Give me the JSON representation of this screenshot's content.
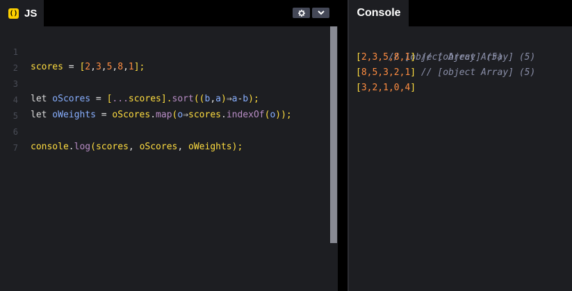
{
  "js_panel": {
    "badge": "()",
    "title": "JS",
    "settings_icon": "gear-icon",
    "collapse_icon": "chevron-down-icon",
    "line_numbers": [
      "1",
      "2",
      "3",
      "4",
      "5",
      "6",
      "7"
    ],
    "code": {
      "l1": {
        "a": "scores",
        "b": " = ",
        "c": "[",
        "d": "2",
        "e": ",",
        "f": "3",
        "g": ",",
        "h": "5",
        "i": ",",
        "j": "8",
        "k": ",",
        "l": "1",
        "m": "];"
      },
      "l3": {
        "kw": "let",
        "v": " oScores",
        "eq": " = ",
        "b1": "[",
        "sp": "...",
        "s": "scores",
        "b2": "].",
        "fn": "sort",
        "p1": "((",
        "x1": "b",
        "cm": ",",
        "x2": "a",
        "p2": ")",
        "ar": "⇒",
        "e1": "a",
        "mi": "-",
        "e2": "b",
        "end": ");"
      },
      "l4": {
        "kw": "let",
        "v": " oWeights",
        "eq": " = ",
        "o": "oScores",
        "dot": ".",
        "fn": "map",
        "p1": "(",
        "x": "o",
        "ar": "⇒",
        "s": "scores",
        "dot2": ".",
        "fn2": "indexOf",
        "p2": "(",
        "x2": "o",
        "end": "));"
      },
      "l6": {
        "c": "console",
        "dot": ".",
        "fn": "log",
        "p1": "(",
        "a": "scores",
        "cm1": ", ",
        "b": "oScores",
        "cm2": ", ",
        "d": "oWeights",
        "end": ");"
      }
    }
  },
  "console": {
    "title": "Console",
    "lines": [
      {
        "comment": "// [object Array] (5)"
      },
      {
        "open": "[",
        "vals": "2,3,5,8,1",
        "close": "]",
        "comment": " // [object Array] (5)"
      },
      {
        "open": "[",
        "vals": "8,5,3,2,1",
        "close": "]",
        "comment": " // [object Array] (5)"
      },
      {
        "open": "[",
        "vals": "3,2,1,0,4",
        "close": "]"
      }
    ]
  },
  "colors": {
    "background": "#1d1e22",
    "header": "#000000",
    "badge": "#fcd000",
    "identifier": "#ffdd40",
    "number": "#ff8d41",
    "variable": "#88afff",
    "function": "#b98dc6",
    "comment": "#8a8fa8"
  }
}
